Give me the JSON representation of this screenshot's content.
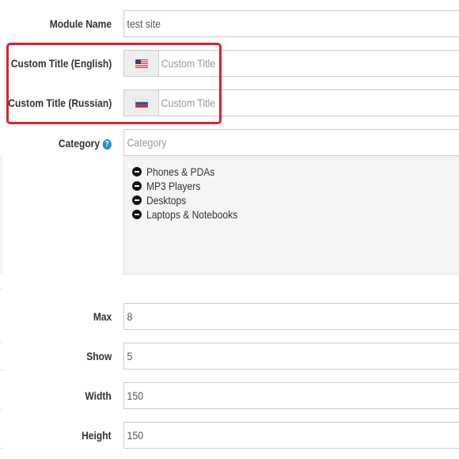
{
  "form": {
    "module_name": {
      "label": "Module Name",
      "value": "test site"
    },
    "custom_title_en": {
      "label": "Custom Title (English)",
      "placeholder": "Custom Title",
      "flag": "us-flag-icon"
    },
    "custom_title_ru": {
      "label": "Custom Title (Russian)",
      "placeholder": "Custom Title",
      "flag": "ru-flag-icon"
    },
    "category": {
      "label": "Category",
      "help_glyph": "?",
      "placeholder": "Category",
      "selected": [
        "Phones & PDAs",
        "MP3 Players",
        "Desktops",
        "Laptops & Notebooks"
      ]
    },
    "max": {
      "label": "Max",
      "value": "8"
    },
    "show": {
      "label": "Show",
      "value": "5"
    },
    "width": {
      "label": "Width",
      "value": "150"
    },
    "height": {
      "label": "Height",
      "value": "150"
    }
  },
  "colors": {
    "highlight": "#e0202c",
    "help_icon": "#1e91cf",
    "input_border": "#cccccc",
    "label_text": "#333333"
  }
}
